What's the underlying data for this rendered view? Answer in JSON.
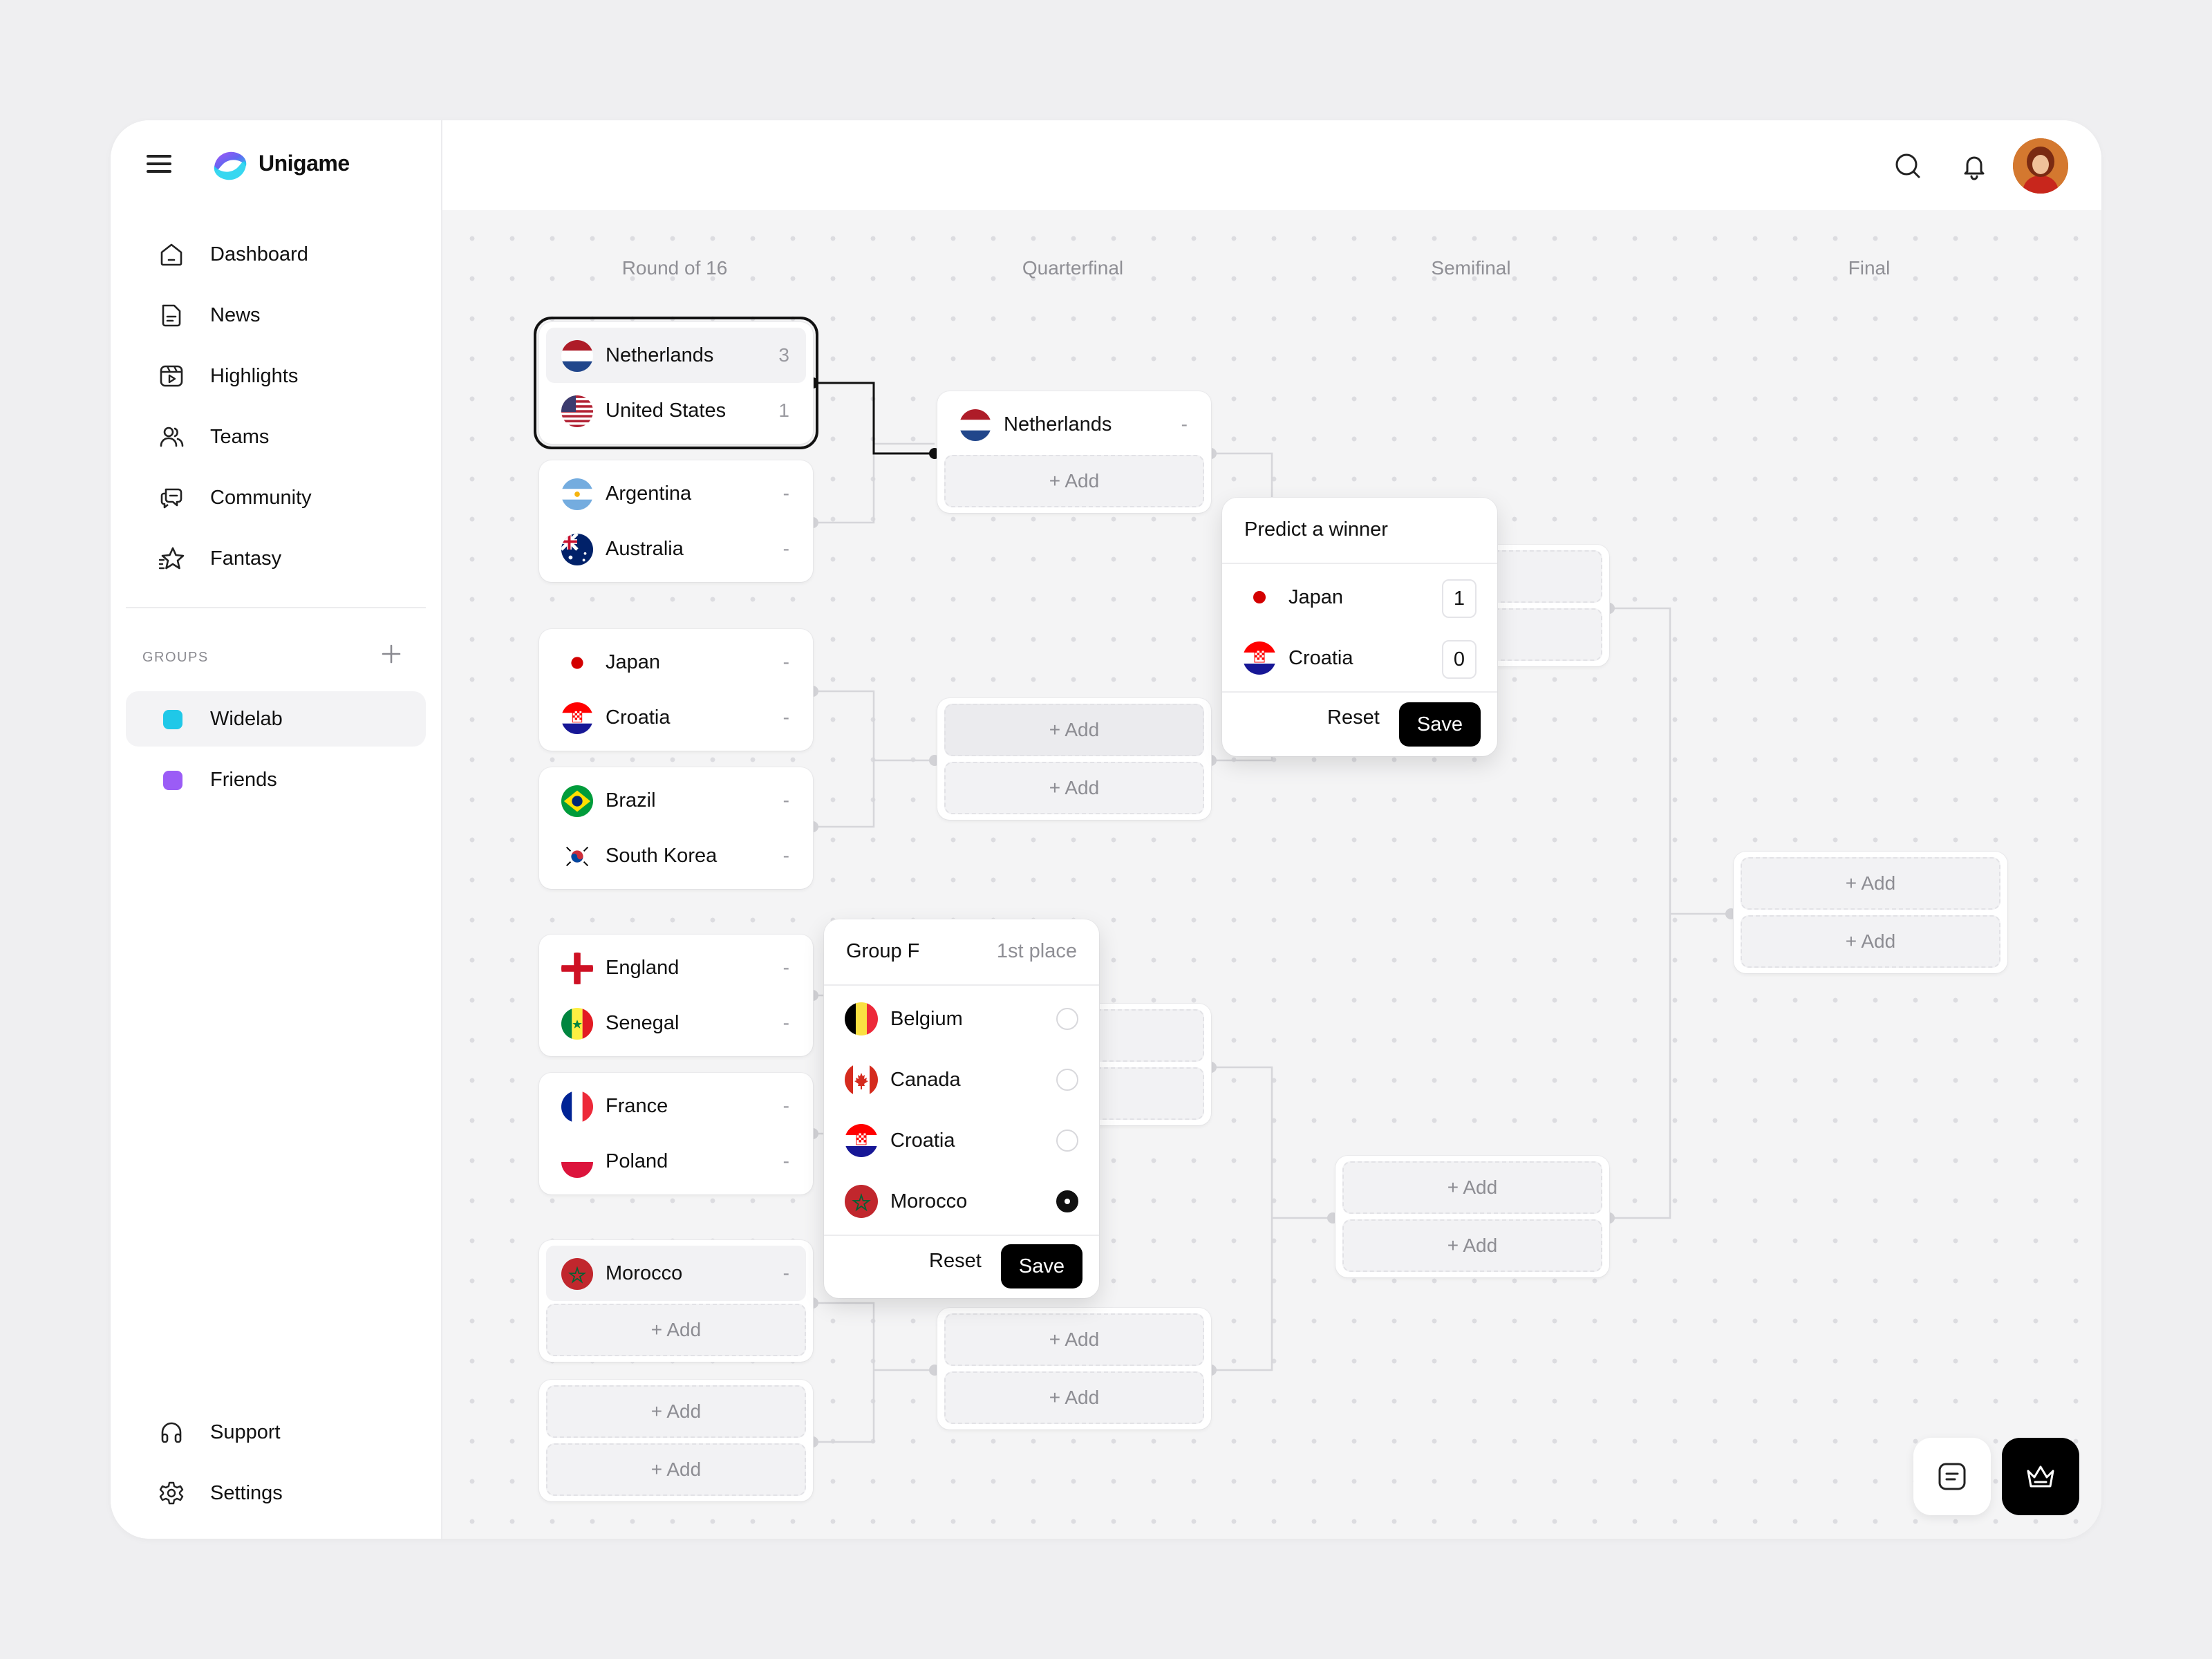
{
  "app": {
    "brand": "Unigame"
  },
  "nav": [
    {
      "label": "Dashboard",
      "icon": "home-icon"
    },
    {
      "label": "News",
      "icon": "news-icon"
    },
    {
      "label": "Highlights",
      "icon": "highlights-icon"
    },
    {
      "label": "Teams",
      "icon": "teams-icon"
    },
    {
      "label": "Community",
      "icon": "community-icon"
    },
    {
      "label": "Fantasy",
      "icon": "fantasy-star-icon"
    }
  ],
  "groups": {
    "title": "GROUPS",
    "items": [
      {
        "label": "Widelab",
        "color": "#1fc8e8",
        "active": true
      },
      {
        "label": "Friends",
        "color": "#9b5cf6"
      }
    ]
  },
  "footer_nav": [
    {
      "label": "Support",
      "icon": "headphones-icon"
    },
    {
      "label": "Settings",
      "icon": "gear-icon"
    }
  ],
  "bracket": {
    "columns": [
      "Round of 16",
      "Quarterfinal",
      "Semifinal",
      "Final"
    ],
    "add_label": "+ Add",
    "round16": [
      {
        "teams": [
          {
            "name": "Netherlands",
            "score": "3"
          },
          {
            "name": "United States",
            "score": "1"
          }
        ]
      },
      {
        "teams": [
          {
            "name": "Argentina",
            "score": "-"
          },
          {
            "name": "Australia",
            "score": "-"
          }
        ]
      },
      {
        "teams": [
          {
            "name": "Japan",
            "score": "-"
          },
          {
            "name": "Croatia",
            "score": "-"
          }
        ]
      },
      {
        "teams": [
          {
            "name": "Brazil",
            "score": "-"
          },
          {
            "name": "South Korea",
            "score": "-"
          }
        ]
      },
      {
        "teams": [
          {
            "name": "England",
            "score": "-"
          },
          {
            "name": "Senegal",
            "score": "-"
          }
        ]
      },
      {
        "teams": [
          {
            "name": "France",
            "score": "-"
          },
          {
            "name": "Poland",
            "score": "-"
          }
        ]
      },
      {
        "teams": [
          {
            "name": "Morocco",
            "score": "-"
          }
        ]
      }
    ],
    "quarterfinal": [
      {
        "teams": [
          {
            "name": "Netherlands",
            "score": "-"
          }
        ]
      }
    ]
  },
  "predict_popup": {
    "title": "Predict a winner",
    "teams": [
      {
        "name": "Japan",
        "score": "1"
      },
      {
        "name": "Croatia",
        "score": "0"
      }
    ],
    "reset": "Reset",
    "save": "Save"
  },
  "group_popup": {
    "title": "Group F",
    "subtitle": "1st place",
    "options": [
      {
        "name": "Belgium",
        "selected": false
      },
      {
        "name": "Canada",
        "selected": false
      },
      {
        "name": "Croatia",
        "selected": false
      },
      {
        "name": "Morocco",
        "selected": true
      }
    ],
    "reset": "Reset",
    "save": "Save"
  },
  "colors": {
    "accent": "#000000",
    "canvas": "#f4f4f5"
  }
}
